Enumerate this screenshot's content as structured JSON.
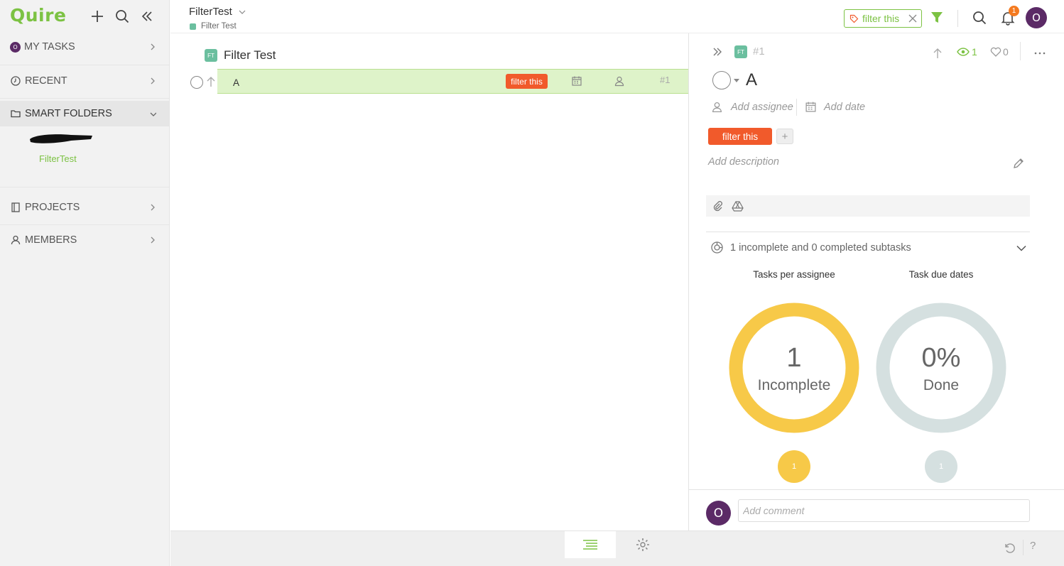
{
  "sidebar": {
    "logo": "Quire",
    "nav": {
      "my_tasks": "MY TASKS",
      "my_tasks_avatar": "O",
      "recent": "RECENT",
      "smart_folders": "SMART FOLDERS",
      "projects": "PROJECTS",
      "members": "MEMBERS"
    },
    "smart_folder_item": "FilterTest"
  },
  "header": {
    "project_title": "FilterTest",
    "project_subtitle": "Filter Test",
    "filter_chip": "filter this",
    "notification_count": "1",
    "avatar": "O"
  },
  "task_list": {
    "badge": "FT",
    "title": "Filter Test",
    "task": {
      "name": "A",
      "tag": "filter this",
      "id": "#1"
    }
  },
  "detail": {
    "badge": "FT",
    "id": "#1",
    "watchers": "1",
    "likes": "0",
    "title": "A",
    "add_assignee": "Add assignee",
    "add_date": "Add date",
    "tag": "filter this",
    "add_tag": "+",
    "add_description": "Add description",
    "subtasks_summary": "1 incomplete and 0 completed subtasks",
    "chart_assignee_title": "Tasks per assignee",
    "chart_due_title": "Task due dates",
    "chart_assignee_number": "1",
    "chart_assignee_label": "Incomplete",
    "chart_due_number": "0%",
    "chart_due_label": "Done",
    "mini_assignee": "1",
    "mini_due": "1",
    "comment_avatar": "O",
    "comment_placeholder": "Add comment"
  },
  "bottombar": {
    "help": "?"
  },
  "colors": {
    "brand_green": "#7cc243",
    "tag_red": "#f15a2b",
    "avatar_purple": "#5b2a66",
    "donut_yellow": "#f7c948",
    "donut_grey": "#d5e0e0",
    "notif_orange": "#f47a20",
    "ft_badge": "#6bbf9f"
  }
}
